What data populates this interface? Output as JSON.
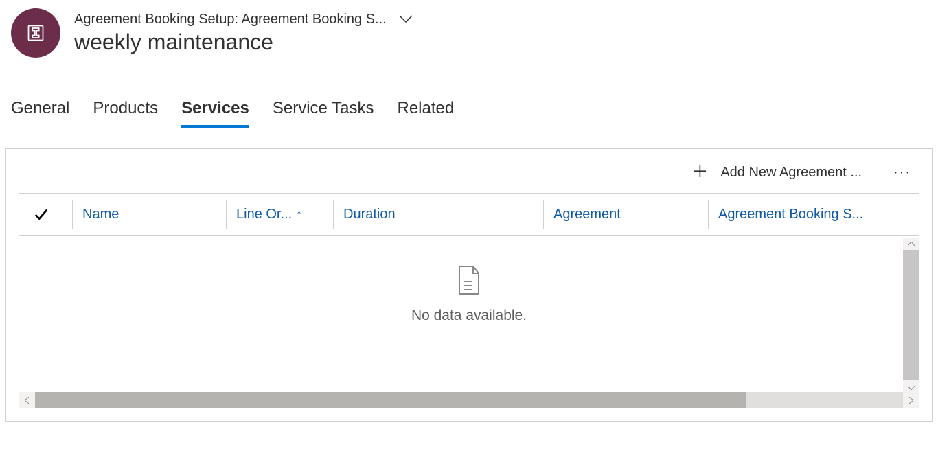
{
  "header": {
    "breadcrumb": "Agreement Booking Setup: Agreement Booking S...",
    "title": "weekly maintenance"
  },
  "tabs": {
    "general": "General",
    "products": "Products",
    "services": "Services",
    "service_tasks": "Service Tasks",
    "related": "Related",
    "active": "services"
  },
  "grid": {
    "add_label": "Add New Agreement ...",
    "columns": {
      "name": "Name",
      "line_order": "Line Or...",
      "duration": "Duration",
      "agreement": "Agreement",
      "agreement_booking_setup": "Agreement Booking S..."
    },
    "sort_column": "line_order",
    "sort_direction": "asc",
    "empty_message": "No data available."
  }
}
